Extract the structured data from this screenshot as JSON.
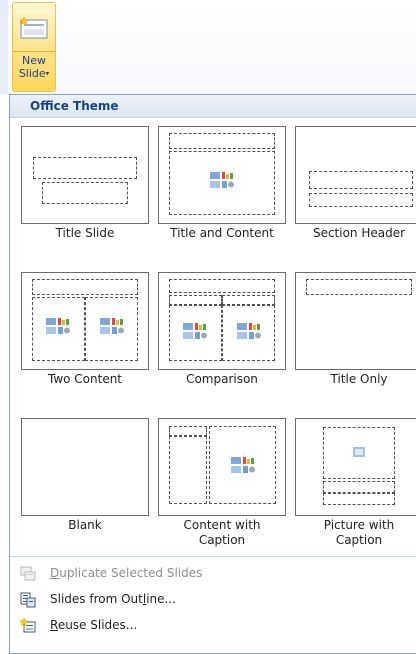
{
  "ribbon": {
    "new_slide_line1": "New",
    "new_slide_line2": "Slide",
    "dropdown_arrow": "▾"
  },
  "gallery": {
    "theme_name": "Office Theme",
    "layouts": [
      {
        "label": "Title Slide"
      },
      {
        "label": "Title and Content"
      },
      {
        "label": "Section Header"
      },
      {
        "label": "Two Content"
      },
      {
        "label": "Comparison"
      },
      {
        "label": "Title Only"
      },
      {
        "label": "Blank"
      },
      {
        "label_line1": "Content with",
        "label_line2": "Caption"
      },
      {
        "label_line1": "Picture with",
        "label_line2": "Caption"
      }
    ]
  },
  "menu": {
    "items": [
      {
        "pre": "",
        "key": "D",
        "post": "uplicate Selected Slides",
        "enabled": false,
        "icon": "duplicate-slides-icon"
      },
      {
        "pre": "Slides from Out",
        "key": "l",
        "post": "ine...",
        "enabled": true,
        "icon": "slides-from-outline-icon"
      },
      {
        "pre": "",
        "key": "R",
        "post": "euse Slides...",
        "enabled": true,
        "icon": "reuse-slides-icon"
      }
    ]
  },
  "colors": {
    "accent": "#15428b",
    "button_highlight": "#ffd65a",
    "panel_border": "#8ba2c1"
  }
}
